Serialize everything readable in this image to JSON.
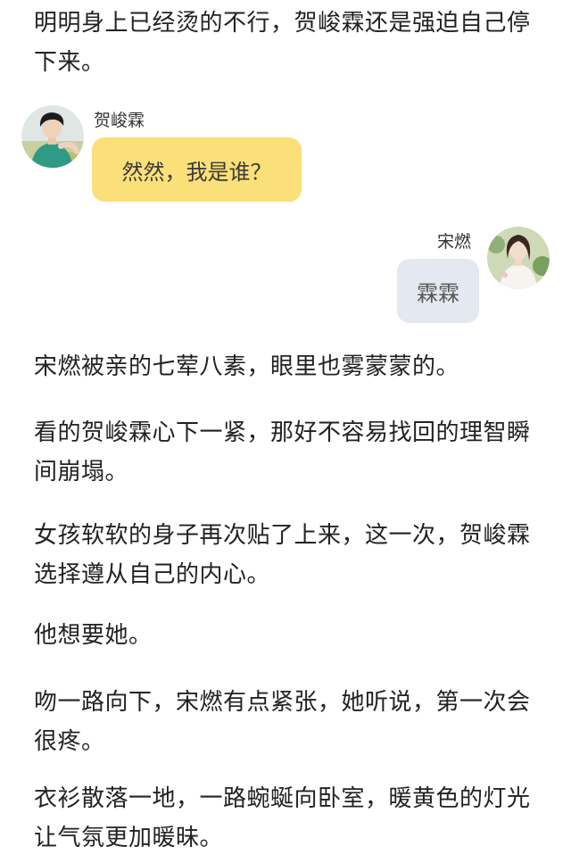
{
  "paragraphs": [
    "明明身上已经烫的不行，贺峻霖还是强迫自己停下来。",
    "宋燃被亲的七荤八素，眼里也雾蒙蒙的。",
    "看的贺峻霖心下一紧，那好不容易找回的理智瞬间崩塌。",
    "女孩软软的身子再次贴了上来，这一次，贺峻霖选择遵从自己的内心。",
    "他想要她。",
    "吻一路向下，宋燃有点紧张，她听说，第一次会很疼。",
    "衣衫散落一地，一路蜿蜒向卧室，暖黄色的灯光让气氛更加暖昧。"
  ],
  "chat": {
    "left": {
      "name": "贺峻霖",
      "message": "然然，我是谁？",
      "bubble_color": "#fbe07a"
    },
    "right": {
      "name": "宋燃",
      "message": "霖霖",
      "bubble_color": "#e4e9f1"
    }
  }
}
